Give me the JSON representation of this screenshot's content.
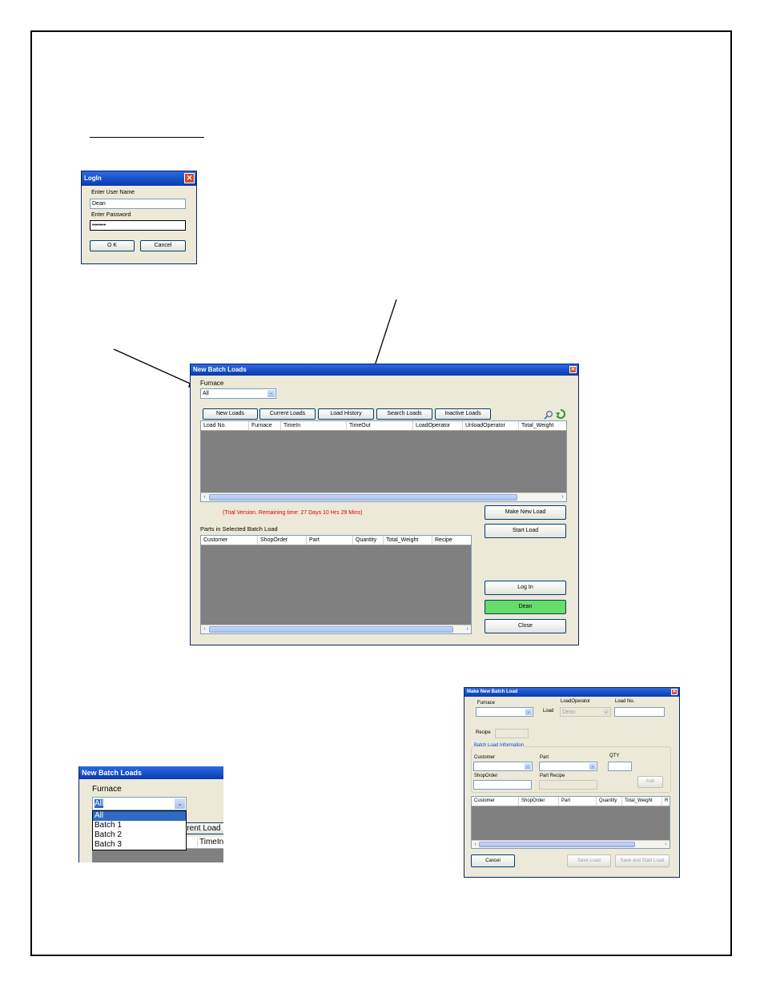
{
  "login": {
    "title": "LogIn",
    "close_glyph": "✕",
    "user_label": "Enter User Name",
    "user_value": "Dean",
    "password_label": "Enter Password",
    "password_value": "•••••••",
    "ok": "O K",
    "cancel": "Cancel"
  },
  "main": {
    "title": "New Batch Loads",
    "close_glyph": "✕",
    "furnace_label": "Furnace",
    "furnace_value": "All",
    "dd_glyph": "⌄",
    "tabs": [
      "New Loads",
      "Current Loads",
      "Load History",
      "Search Loads",
      "Inactive Loads"
    ],
    "icons": [
      "search-icon",
      "refresh-icon"
    ],
    "loads_columns": [
      "Load No.",
      "Furnace",
      "TimeIn",
      "TimeOut",
      "LoadOperator",
      "UnloadOperator",
      "Total_Weight"
    ],
    "trial_text": "(Trial Version.  Remaining time: 27 Days 10 Hrs 29 Mins)",
    "trial_color": "#e00000",
    "parts_label": "Parts in Selected Batch Load",
    "parts_columns": [
      "Customer",
      "ShopOrder",
      "Part",
      "Quantity",
      "Total_Weight",
      "Recipe"
    ],
    "buttons": {
      "make_new_load": "Make New Load",
      "start_load": "Start Load",
      "log_in": "Log In",
      "user": "Dean",
      "close": "Close"
    },
    "user_button_color": "#66dd66",
    "scroll_left": "‹",
    "scroll_right": "›"
  },
  "dropdown_zoom": {
    "title": "New Batch Loads",
    "furnace_label": "Furnace",
    "selected": "All",
    "dd_glyph": "⌄",
    "options": [
      "All",
      "Batch 1",
      "Batch 2",
      "Batch 3"
    ],
    "tab_fragment": "rrent Load",
    "col_fragment": "TimeIn"
  },
  "make_new": {
    "title": "Make New Batch Load",
    "close_glyph": "✕",
    "furnace_label": "Furnace",
    "load_label": "Load",
    "load_operator_label": "LoadOperator",
    "load_operator_value": "Dean",
    "load_no_label": "Load No.",
    "recipe_label": "Recipe",
    "group_label": "Batch Load Information",
    "customer_label": "Customer",
    "part_label": "Part",
    "qty_label": "QTY",
    "shop_order_label": "ShopOrder",
    "part_recipe_label": "Part Recipe",
    "add": "Add",
    "columns": [
      "Customer",
      "ShopOrder",
      "Part",
      "Quantity",
      "Total_Weight",
      "R"
    ],
    "cancel": "Cancel",
    "save_load": "Save Load",
    "save_start": "Save and Start Load",
    "dd_glyph": "⌄",
    "scroll_left": "‹",
    "scroll_right": "›"
  }
}
